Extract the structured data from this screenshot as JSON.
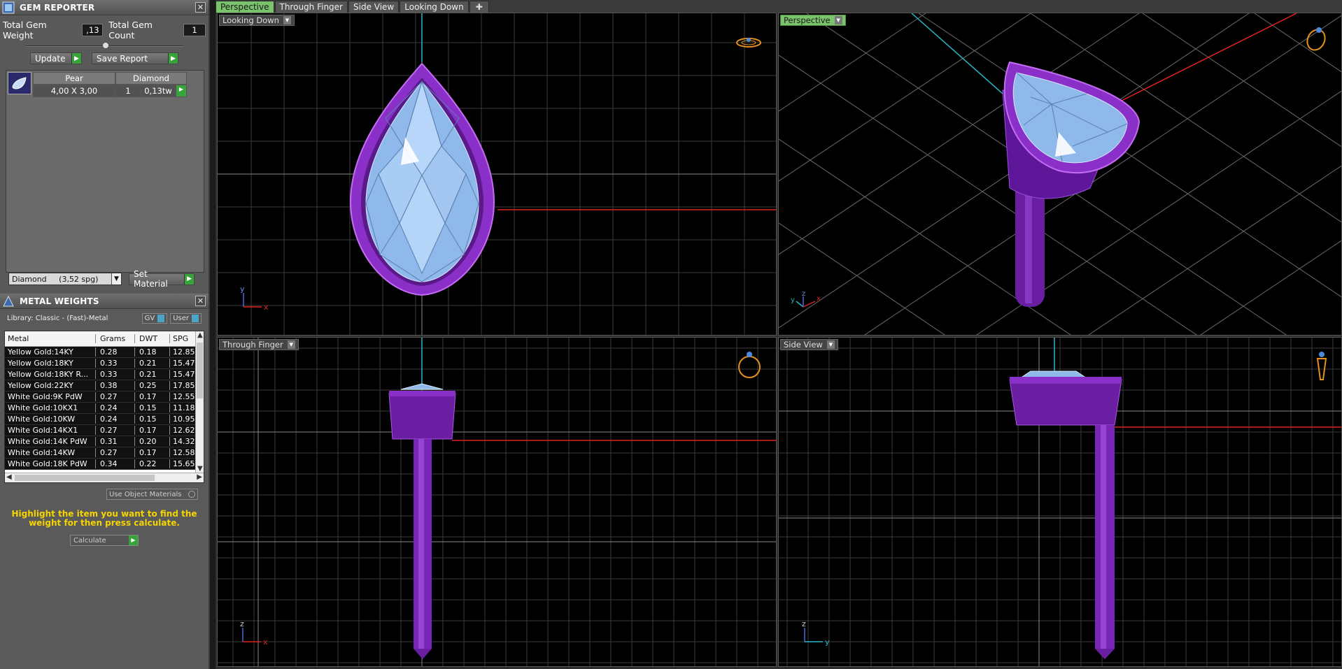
{
  "gem_reporter": {
    "title": "GEM REPORTER",
    "total_weight_label": "Total Gem Weight",
    "total_weight_value": ",13",
    "total_count_label": "Total Gem Count",
    "total_count_value": "1",
    "update_label": "Update",
    "save_report_label": "Save Report",
    "gem": {
      "shape": "Pear",
      "material": "Diamond",
      "size": "4,00 X 3,00",
      "count": "1",
      "weight": "0,13tw"
    },
    "material_select": "Diamond     (3,52 spg)",
    "set_material_label": "Set Material"
  },
  "metal_weights": {
    "title": "METAL WEIGHTS",
    "library": "Library: Classic - (Fast)-Metal",
    "gv_label": "GV",
    "user_label": "User",
    "columns": [
      "Metal",
      "Grams",
      "DWT",
      "SPG"
    ],
    "rows": [
      [
        "Yellow Gold:14KY",
        "0.28",
        "0.18",
        "12.85"
      ],
      [
        "Yellow Gold:18KY",
        "0.33",
        "0.21",
        "15.47"
      ],
      [
        "Yellow Gold:18KY R...",
        "0.33",
        "0.21",
        "15.47"
      ],
      [
        "Yellow Gold:22KY",
        "0.38",
        "0.25",
        "17.85"
      ],
      [
        "White Gold:9K PdW",
        "0.27",
        "0.17",
        "12.55"
      ],
      [
        "White Gold:10KX1",
        "0.24",
        "0.15",
        "11.18"
      ],
      [
        "White Gold:10KW",
        "0.24",
        "0.15",
        "10.95"
      ],
      [
        "White Gold:14KX1",
        "0.27",
        "0.17",
        "12.62"
      ],
      [
        "White Gold:14K PdW",
        "0.31",
        "0.20",
        "14.32"
      ],
      [
        "White Gold:14KW",
        "0.27",
        "0.17",
        "12.58"
      ],
      [
        "White Gold:18K PdW",
        "0.34",
        "0.22",
        "15.65"
      ]
    ],
    "use_object_materials": "Use Object Materials",
    "hint": "Highlight the item you want to find the weight for then press calculate.",
    "calculate_label": "Calculate"
  },
  "tabs": [
    "Perspective",
    "Through Finger",
    "Side View",
    "Looking Down"
  ],
  "viewports": {
    "top_left": "Looking Down",
    "top_right": "Perspective",
    "bottom_left": "Through Finger",
    "bottom_right": "Side View"
  },
  "axes": {
    "y": "y",
    "x": "x",
    "z": "z"
  },
  "colors": {
    "metal": "#8b2fc9",
    "gem": "#9cc8f2",
    "active_tab": "#7ac26b",
    "hint": "#f5d400"
  }
}
